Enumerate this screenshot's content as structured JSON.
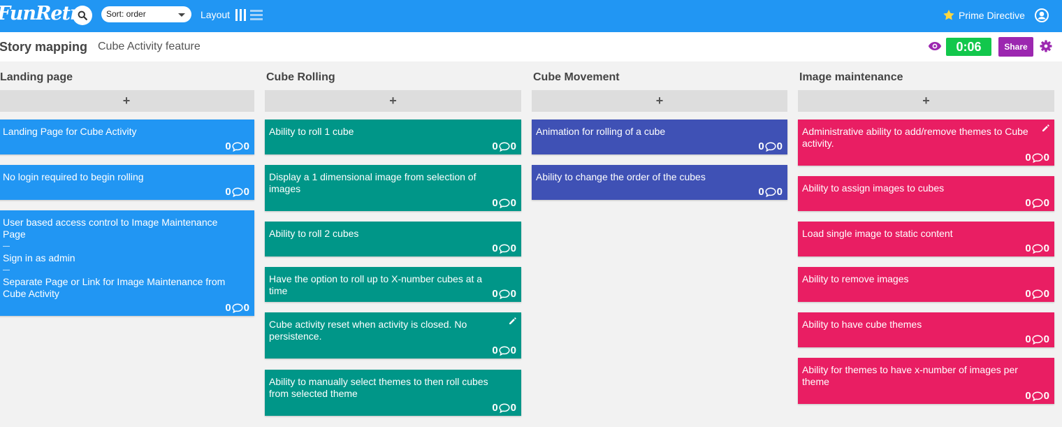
{
  "header": {
    "logo": "FunRetro",
    "sort_label": "Sort: order",
    "layout_label": "Layout",
    "prime_directive": "Prime Directive"
  },
  "board": {
    "title": "Story mapping",
    "subtitle": "Cube Activity feature",
    "timer": "0:06",
    "share_label": "Share"
  },
  "columns": [
    {
      "title": "Landing page",
      "add_label": "+",
      "color": "#2196f3",
      "cards": [
        {
          "lines": [
            "Landing Page for Cube Activity"
          ],
          "votes": "0",
          "comments": "0"
        },
        {
          "lines": [
            "No login required to begin rolling"
          ],
          "votes": "0",
          "comments": "0"
        },
        {
          "lines": [
            "User based access control to Image Maintenance",
            "Page",
            "—",
            "Sign in as admin",
            "—",
            "Separate Page or Link for Image Maintenance from",
            "Cube Activity"
          ],
          "votes": "0",
          "comments": "0"
        }
      ]
    },
    {
      "title": "Cube Rolling",
      "add_label": "+",
      "color": "#009688",
      "cards": [
        {
          "lines": [
            "Ability to roll 1 cube"
          ],
          "votes": "0",
          "comments": "0"
        },
        {
          "lines": [
            "Display a 1 dimensional image from selection of",
            "images"
          ],
          "votes": "0",
          "comments": "0"
        },
        {
          "lines": [
            "Ability to roll 2 cubes"
          ],
          "votes": "0",
          "comments": "0"
        },
        {
          "lines": [
            "Have the option to roll up to X-number cubes at a time"
          ],
          "votes": "0",
          "comments": "0"
        },
        {
          "lines": [
            "Cube activity reset when activity is closed. No",
            "persistence."
          ],
          "votes": "0",
          "comments": "0"
        },
        {
          "lines": [
            "Ability to manually select themes to then roll cubes",
            "from selected theme"
          ],
          "votes": "0",
          "comments": "0"
        }
      ]
    },
    {
      "title": "Cube Movement",
      "add_label": "+",
      "color": "#3f51b5",
      "cards": [
        {
          "lines": [
            "Animation for rolling of a cube"
          ],
          "votes": "0",
          "comments": "0"
        },
        {
          "lines": [
            "Ability to change the order of the cubes"
          ],
          "votes": "0",
          "comments": "0"
        }
      ]
    },
    {
      "title": "Image maintenance",
      "add_label": "+",
      "color": "#e91e63",
      "cards": [
        {
          "lines": [
            "Administrative ability to add/remove themes to Cube",
            "activity."
          ],
          "votes": "0",
          "comments": "0"
        },
        {
          "lines": [
            "Ability to assign images to cubes"
          ],
          "votes": "0",
          "comments": "0"
        },
        {
          "lines": [
            "Load single image to static content"
          ],
          "votes": "0",
          "comments": "0"
        },
        {
          "lines": [
            "Ability to remove images"
          ],
          "votes": "0",
          "comments": "0"
        },
        {
          "lines": [
            "Ability to have cube themes"
          ],
          "votes": "0",
          "comments": "0"
        },
        {
          "lines": [
            "Ability for themes to have x-number of images per",
            "theme"
          ],
          "votes": "0",
          "comments": "0"
        }
      ]
    }
  ]
}
